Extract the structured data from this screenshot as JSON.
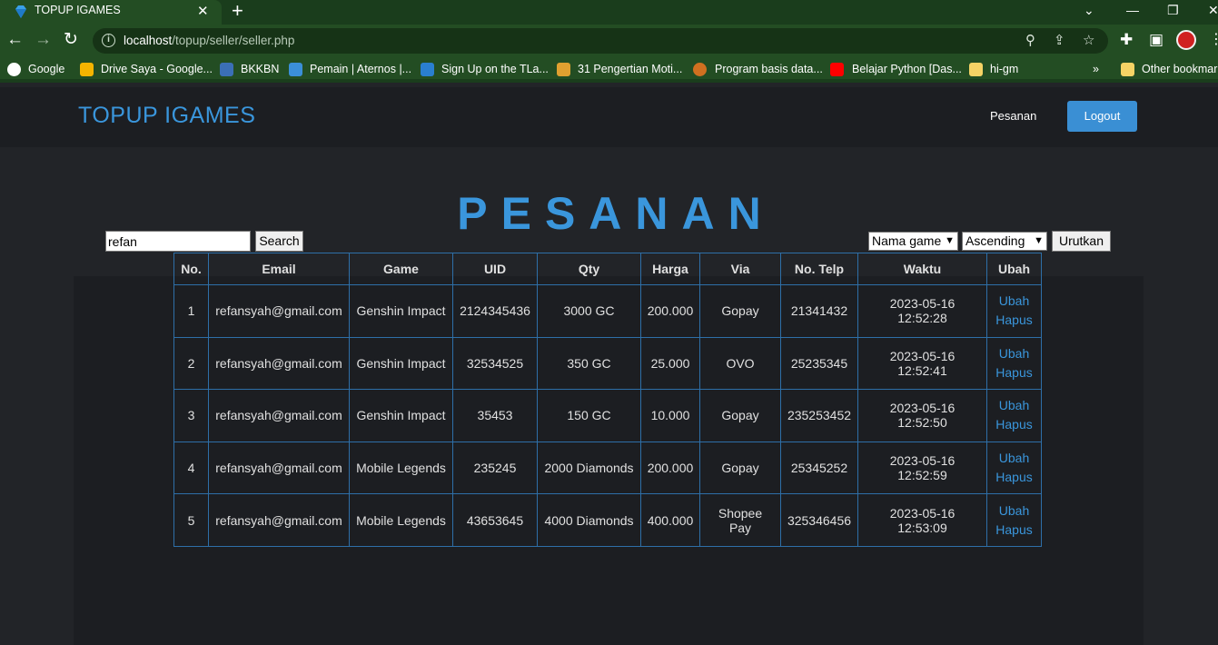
{
  "browser": {
    "tab_title": "TOPUP IGAMES",
    "url_host": "localhost",
    "url_path": "/topup/seller/seller.php",
    "bookmarks": [
      {
        "label": "Google",
        "color": "#4285f4"
      },
      {
        "label": "Drive Saya - Google...",
        "color": "#f4b400"
      },
      {
        "label": "BKKBN",
        "color": "#3b6fb6"
      },
      {
        "label": "Pemain | Aternos |...",
        "color": "#3b8fd8"
      },
      {
        "label": "Sign Up on the TLa...",
        "color": "#2a7fd0"
      },
      {
        "label": "31 Pengertian Moti...",
        "color": "#e0a030"
      },
      {
        "label": "Program basis data...",
        "color": "#d07020"
      },
      {
        "label": "Belajar Python [Das...",
        "color": "#ff0000"
      },
      {
        "label": "hi-gm",
        "color": "#f6d365"
      }
    ],
    "overflow_label": "»",
    "other_bookmarks": "Other bookmarks"
  },
  "site": {
    "brand": "TOPUP IGAMES",
    "nav_orders": "Pesanan",
    "logout": "Logout",
    "accent": "#3a96dc"
  },
  "page": {
    "heading": "PESANAN"
  },
  "controls": {
    "search_value": "refan",
    "search_button": "Search",
    "sort_field": "Nama game",
    "sort_order": "Ascending",
    "sort_button": "Urutkan"
  },
  "table": {
    "headers": [
      "No.",
      "Email",
      "Game",
      "UID",
      "Qty",
      "Harga",
      "Via",
      "No. Telp",
      "Waktu",
      "Ubah"
    ],
    "edit_label": "Ubah",
    "delete_label": "Hapus",
    "rows": [
      {
        "no": "1",
        "email": "refansyah@gmail.com",
        "game": "Genshin Impact",
        "uid": "2124345436",
        "qty": "3000 GC",
        "harga": "200.000",
        "via": "Gopay",
        "telp": "21341432",
        "waktu": "2023-05-16 12:52:28"
      },
      {
        "no": "2",
        "email": "refansyah@gmail.com",
        "game": "Genshin Impact",
        "uid": "32534525",
        "qty": "350 GC",
        "harga": "25.000",
        "via": "OVO",
        "telp": "25235345",
        "waktu": "2023-05-16 12:52:41"
      },
      {
        "no": "3",
        "email": "refansyah@gmail.com",
        "game": "Genshin Impact",
        "uid": "35453",
        "qty": "150 GC",
        "harga": "10.000",
        "via": "Gopay",
        "telp": "235253452",
        "waktu": "2023-05-16 12:52:50"
      },
      {
        "no": "4",
        "email": "refansyah@gmail.com",
        "game": "Mobile Legends",
        "uid": "235245",
        "qty": "2000 Diamonds",
        "harga": "200.000",
        "via": "Gopay",
        "telp": "25345252",
        "waktu": "2023-05-16 12:52:59"
      },
      {
        "no": "5",
        "email": "refansyah@gmail.com",
        "game": "Mobile Legends",
        "uid": "43653645",
        "qty": "4000 Diamonds",
        "harga": "400.000",
        "via": "Shopee Pay",
        "telp": "325346456",
        "waktu": "2023-05-16 12:53:09"
      }
    ]
  }
}
